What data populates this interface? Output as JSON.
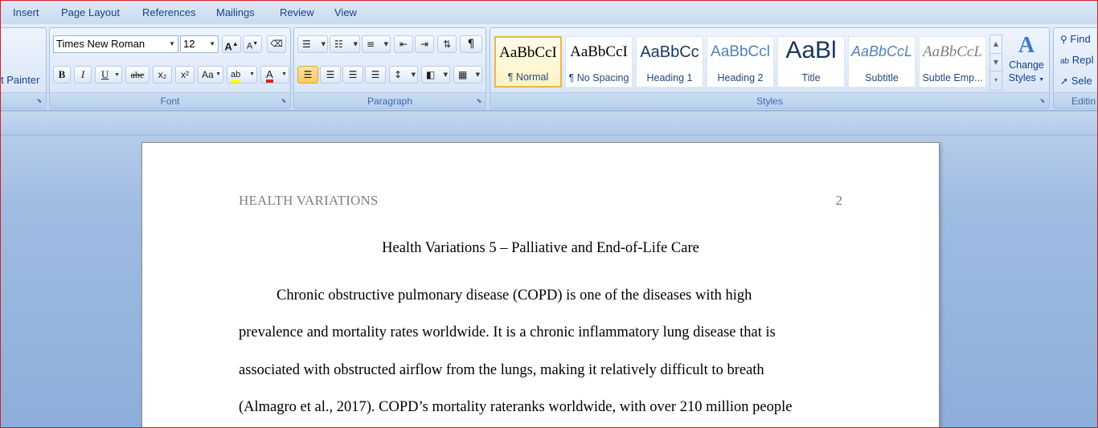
{
  "tabs": [
    "Insert",
    "Page Layout",
    "References",
    "Mailings",
    "Review",
    "View"
  ],
  "clipboard": {
    "format_painter_label": "t Painter"
  },
  "font": {
    "font_name": "Times New Roman",
    "font_size": "12",
    "grow_label": "A",
    "shrink_label": "A",
    "bold_label": "B",
    "italic_label": "I",
    "underline_label": "U",
    "strike_label": "abe",
    "subscript_label": "x₂",
    "superscript_label": "x²",
    "case_label": "Aa",
    "highlight_label": "ab",
    "font_color_label": "A",
    "group_label": "Font",
    "highlight_color": "#ffff00",
    "font_color": "#e02020"
  },
  "paragraph": {
    "group_label": "Paragraph"
  },
  "styles": {
    "items": [
      {
        "sample": "AaBbCcI",
        "name": "¶ Normal",
        "color": "#000000"
      },
      {
        "sample": "AaBbCcI",
        "name": "¶ No Spacing",
        "color": "#000000"
      },
      {
        "sample": "AaBbCc",
        "name": "Heading 1",
        "color": "#17365d"
      },
      {
        "sample": "AaBbCcl",
        "name": "Heading 2",
        "color": "#4f81bd"
      },
      {
        "sample": "AaBl",
        "name": "Title",
        "color": "#17365d"
      },
      {
        "sample": "AaBbCcL",
        "name": "Subtitle",
        "color": "#4f81bd"
      },
      {
        "sample": "AaBbCcL",
        "name": "Subtle Emp...",
        "color": "#808080"
      }
    ],
    "change_styles_line1": "Change",
    "change_styles_line2": "Styles",
    "group_label": "Styles"
  },
  "editing": {
    "find_label": "Find",
    "replace_label": "Repl",
    "select_label": "Sele",
    "group_label": "Editin"
  },
  "document": {
    "header_text": "HEALTH VARIATIONS",
    "page_number": "2",
    "title": "Health Variations 5 – Palliative and End-of-Life Care",
    "lines": [
      "Chronic obstructive pulmonary disease (COPD) is one of the diseases with high",
      "prevalence and mortality rates worldwide. It is a chronic inflammatory lung disease that is",
      "associated with obstructed airflow from the lungs, making it relatively difficult to breath",
      "(Almagro et al., 2017). COPD’s mortality rateranks worldwide, with over 210 million people"
    ]
  }
}
